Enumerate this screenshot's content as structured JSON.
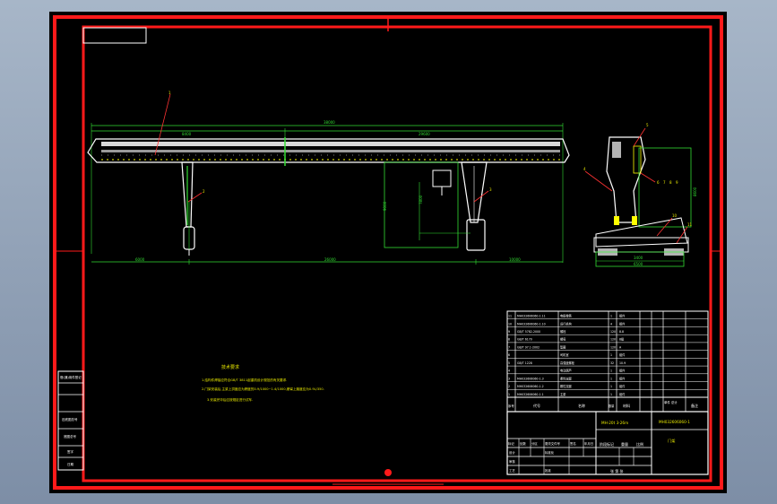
{
  "drawing": {
    "title_block": {
      "drawing_code": "MH032606060-1",
      "machine_desc": "MH-20t 3-26m",
      "view_name": "门架",
      "scale_label": "比例",
      "weight_label": "重量",
      "sheet_label": "张 第 张"
    },
    "tech_requirements": {
      "heading": "技术要求",
      "lines": [
        "1.结构件焊接应符合GB/T 3811起重机设计规范的有关要求.",
        "2.门架安装后,主梁上拱度应为跨度的0.9/1000~1.4/1000,悬臂上翘度应为0.9L/350.",
        "3.安装完毕后应按规定进行试车."
      ]
    },
    "dimensions": {
      "overall": "38000",
      "left_seg": "8400",
      "right_seg": "29600",
      "span": "26000",
      "left_overhang": "6000",
      "right_overhang": "10000",
      "height": "9000",
      "clear_height": "7800",
      "side_width": "3400",
      "side_base": "6500",
      "side_height": "8600"
    },
    "part_labels": [
      "1",
      "2",
      "3",
      "4",
      "5",
      "6",
      "7",
      "8",
      "9",
      "10",
      "11"
    ],
    "bom": [
      {
        "no": "11",
        "code": "MH032606060-1.11",
        "name": "电缆卷筒",
        "qty": "1",
        "mat": "组件"
      },
      {
        "no": "10",
        "code": "MH032606060-1.10",
        "name": "运行机构",
        "qty": "4",
        "mat": "组件"
      },
      {
        "no": "9",
        "code": "GB/T 5782-2000",
        "name": "螺栓",
        "qty": "120",
        "mat": "8.8"
      },
      {
        "no": "8",
        "code": "GB/T 6170",
        "name": "螺母",
        "qty": "120",
        "mat": "8级"
      },
      {
        "no": "7",
        "code": "GB/T 97.1-2002",
        "name": "垫圈",
        "qty": "120",
        "mat": "A"
      },
      {
        "no": "6",
        "code": "",
        "name": "司机室",
        "qty": "1",
        "mat": "组件"
      },
      {
        "no": "5",
        "code": "GB/T 1228",
        "name": "高强度螺栓",
        "qty": "32",
        "mat": "10.9"
      },
      {
        "no": "4",
        "code": "",
        "name": "电动葫芦",
        "qty": "1",
        "mat": "组件"
      },
      {
        "no": "3",
        "code": "MH032606060-1.3",
        "name": "柔性支腿",
        "qty": "1",
        "mat": "组件"
      },
      {
        "no": "2",
        "code": "MH032606060-1.2",
        "name": "刚性支腿",
        "qty": "1",
        "mat": "组件"
      },
      {
        "no": "1",
        "code": "MH032606060-1.1",
        "name": "主梁",
        "qty": "1",
        "mat": "组件"
      }
    ],
    "bom_header": {
      "no": "序号",
      "code": "代号",
      "name": "名称",
      "qty": "数量",
      "mat": "材料",
      "weight": "单件 总计",
      "note": "备注"
    },
    "sign_row": [
      "标记",
      "处数",
      "分区",
      "更改文件号",
      "签名",
      "年月日"
    ],
    "sign_labels": {
      "design": "设计",
      "standard": "标准化",
      "process": "工艺",
      "approve": "批准",
      "stage": "阶段标记",
      "check": "审核"
    },
    "left_block": [
      "借(通)用件登记",
      "旧底图总号",
      "底图总号",
      "签字",
      "日期"
    ]
  }
}
